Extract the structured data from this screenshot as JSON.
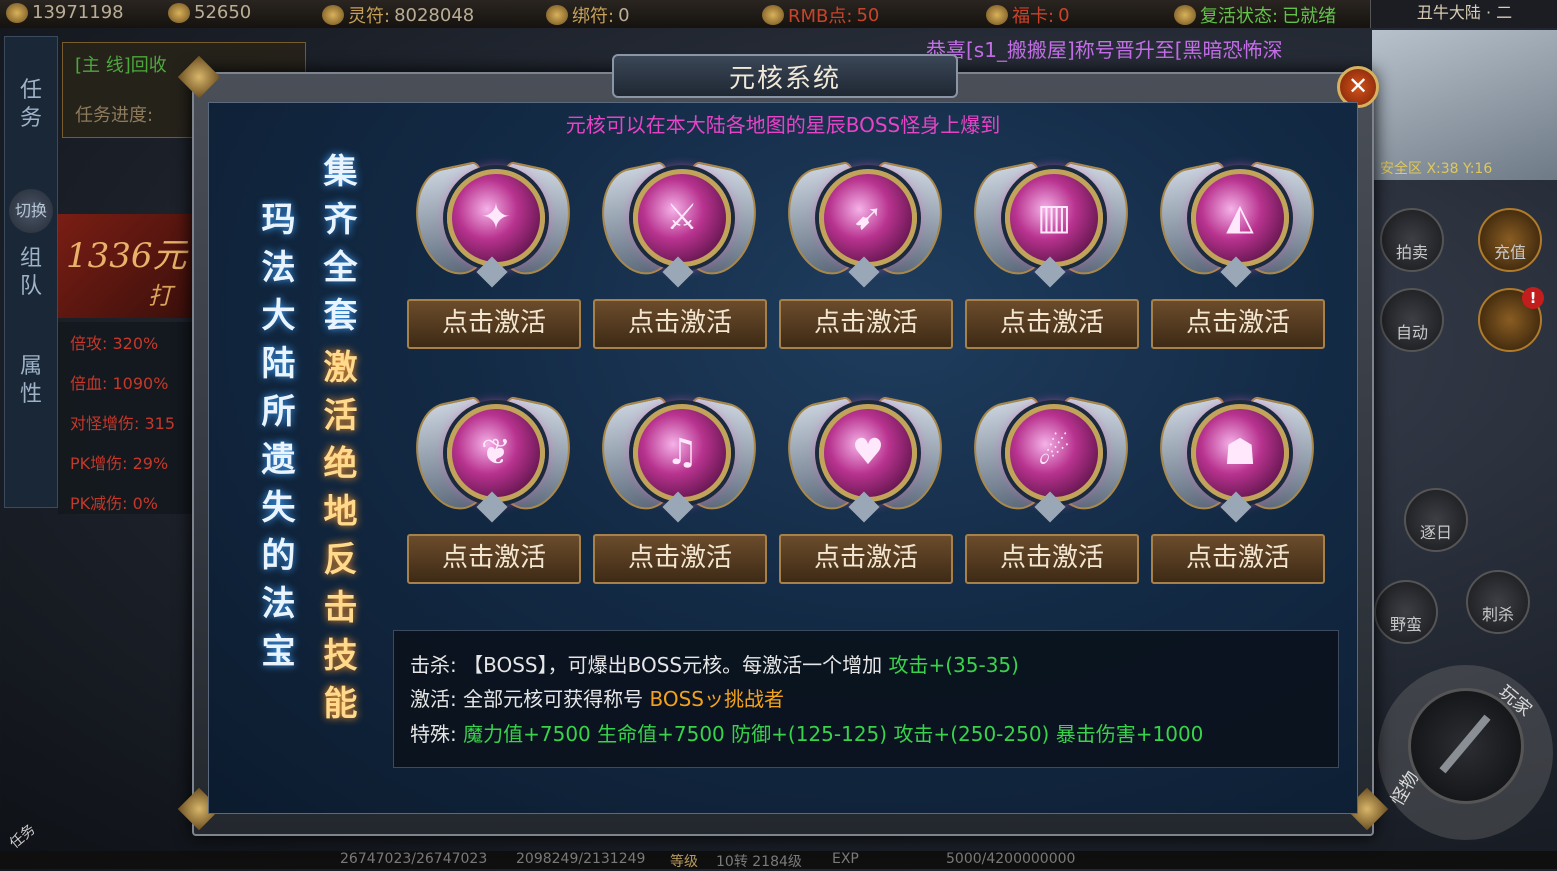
{
  "topbar": {
    "gold": "13971198",
    "ingot": "52650",
    "lingfu_label": "灵符:",
    "lingfu_value": "8028048",
    "bangfu_label": "绑符:",
    "bangfu_value": "0",
    "rmb_label": "RMB点:",
    "rmb_value": "50",
    "fuka_label": "福卡:",
    "fuka_value": "0",
    "revive_label": "复活状态:",
    "revive_value": "已就绪",
    "map_name": "丑牛大陆 · 二"
  },
  "leftnav": {
    "task": "任务",
    "switch": "切换",
    "team": "组队",
    "attr": "属性",
    "quest_title": "[主 线]回收",
    "quest_progress": "任务进度:",
    "promo_amount": "1336元",
    "promo_sub": "打",
    "stats": [
      "倍攻: 320%",
      "倍血: 1090%",
      "对怪增伤: 315",
      "PK增伤: 29%",
      "PK减伤: 0%"
    ]
  },
  "announcement": "恭喜[s1_搬搬屋]称号晋升至[黑暗恐怖深",
  "coords": "安全区 X:38 Y:16",
  "right_buttons": {
    "auction": "拍卖",
    "recharge": "充值",
    "auto": "自动",
    "skill1": "逐日",
    "skill2": "野蛮",
    "skill3": "刺杀",
    "badge": "!",
    "side_a": "玩家",
    "side_b": "怪物"
  },
  "bottombar": {
    "hp": "26747023/26747023",
    "mp": "2098249/2131249",
    "level_label": "等级",
    "level_value": "10转 2184级",
    "exp_label": "EXP",
    "exp_value": "5000/4200000000",
    "corner": "任务"
  },
  "dialog": {
    "title": "元核系统",
    "hint": "元核可以在本大陆各地图的星辰BOSS怪身上爆到",
    "vertical_left": "玛法大陆所遗失的法宝",
    "vertical_right_1": "集齐全套",
    "vertical_right_2": "激活绝地反击技能",
    "activate_label": "点击激活",
    "emblems": [
      "shuriken-icon",
      "warrior-icon",
      "blade-icon",
      "barrier-icon",
      "cloak-icon",
      "wing-icon",
      "music-icon",
      "heart-icon",
      "runner-icon",
      "shadow-icon"
    ],
    "info": {
      "kill_label": "击杀:",
      "kill_text": "【BOSS】，可爆出BOSS元核。每激活一个增加",
      "kill_bonus": "攻击+(35-35)",
      "activate_label": "激活:",
      "activate_text": "全部元核可获得称号",
      "activate_title": "BOSSッ挑战者",
      "special_label": "特殊:",
      "special_1": "魔力值+7500",
      "special_2": "生命值+7500",
      "special_3": "防御+(125-125)",
      "special_4": "攻击+(250-250)",
      "special_5": "暴击伤害+1000"
    }
  }
}
